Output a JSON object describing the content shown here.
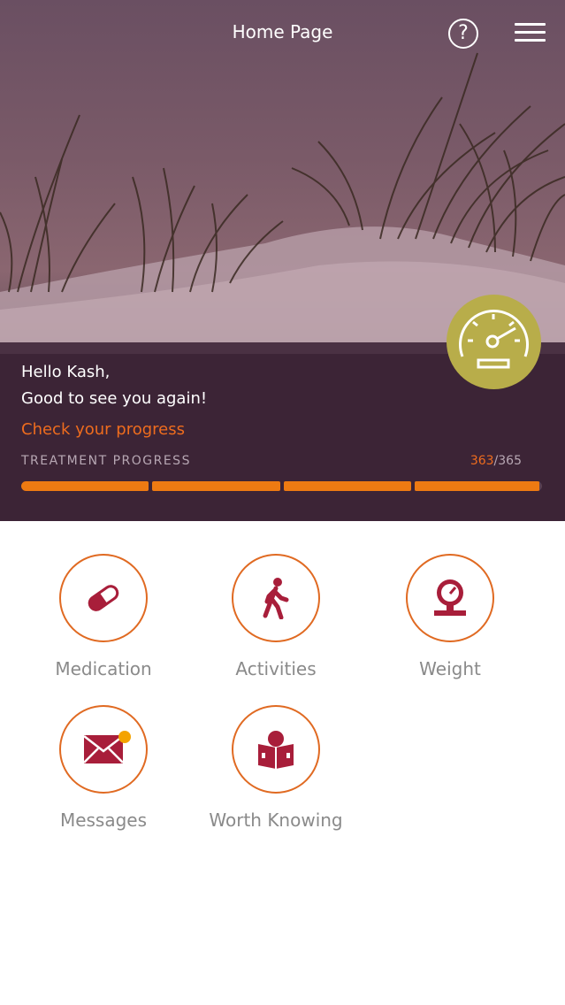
{
  "header": {
    "title": "Home Page"
  },
  "greeting": {
    "line1": "Hello Kash,",
    "line2": "Good to see you again!",
    "link": "Check your progress"
  },
  "progress": {
    "label": "TREATMENT PROGRESS",
    "current": "363",
    "total": "365",
    "value": 363,
    "max": 365,
    "segments": 4
  },
  "tiles": [
    {
      "label": "Medication"
    },
    {
      "label": "Activities"
    },
    {
      "label": "Weight"
    },
    {
      "label": "Messages"
    },
    {
      "label": "Worth Knowing"
    }
  ],
  "colors": {
    "accent": "#ee7a12",
    "icon": "#a81e3a",
    "badge": "#b8ad4a",
    "notification": "#f4a300"
  }
}
